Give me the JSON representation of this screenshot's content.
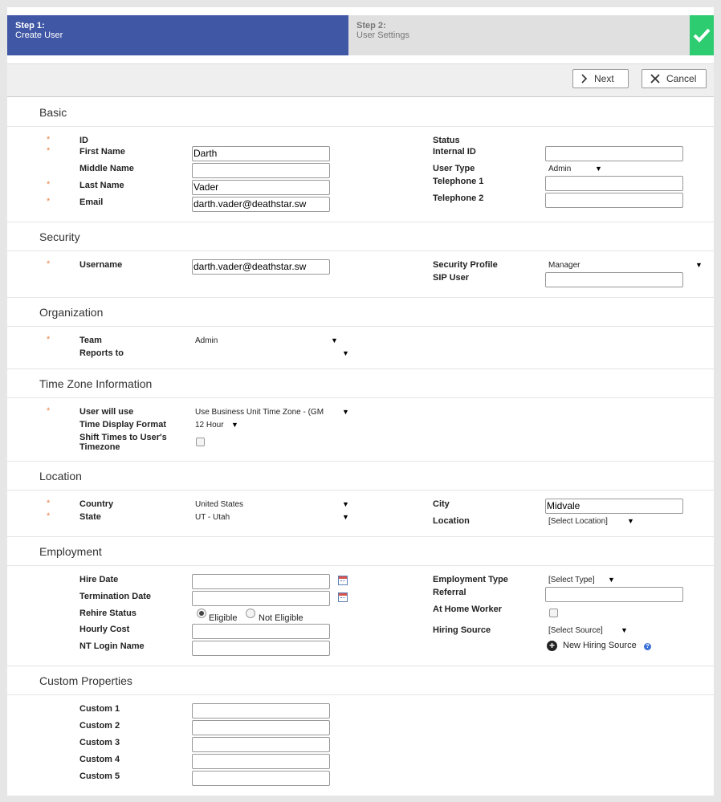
{
  "wizard": {
    "step1_title": "Step 1:",
    "step1_sub": "Create User",
    "step2_title": "Step 2:",
    "step2_sub": "User Settings",
    "complete_icon": "checkmark-icon"
  },
  "toolbar": {
    "next_label": "Next",
    "cancel_label": "Cancel"
  },
  "basic": {
    "title": "Basic",
    "id_label": "ID",
    "first_name_label": "First Name",
    "first_name_value": "Darth",
    "middle_name_label": "Middle Name",
    "middle_name_value": "",
    "last_name_label": "Last Name",
    "last_name_value": "Vader",
    "email_label": "Email",
    "email_value": "darth.vader@deathstar.sw",
    "status_label": "Status",
    "internal_id_label": "Internal ID",
    "internal_id_value": "",
    "user_type_label": "User Type",
    "user_type_value": "Admin",
    "telephone1_label": "Telephone 1",
    "telephone1_value": "",
    "telephone2_label": "Telephone 2",
    "telephone2_value": ""
  },
  "security": {
    "title": "Security",
    "username_label": "Username",
    "username_value": "darth.vader@deathstar.sw",
    "profile_label": "Security Profile",
    "profile_value": "Manager",
    "sip_label": "SIP User",
    "sip_value": ""
  },
  "organization": {
    "title": "Organization",
    "team_label": "Team",
    "team_value": "Admin",
    "reports_label": "Reports to",
    "reports_value": ""
  },
  "timezone": {
    "title": "Time Zone Information",
    "use_label": "User will use",
    "use_value": "Use Business Unit Time Zone - (GM",
    "format_label": "Time Display Format",
    "format_value": "12 Hour",
    "shift_label_1": "Shift Times to User's",
    "shift_label_2": "Timezone"
  },
  "location": {
    "title": "Location",
    "country_label": "Country",
    "country_value": "United States",
    "state_label": "State",
    "state_value": "UT - Utah",
    "city_label": "City",
    "city_value": "Midvale",
    "location_label": "Location",
    "location_value": "[Select Location]"
  },
  "employment": {
    "title": "Employment",
    "hire_label": "Hire Date",
    "hire_value": "",
    "term_label": "Termination Date",
    "term_value": "",
    "rehire_label": "Rehire Status",
    "eligible_label": "Eligible",
    "not_eligible_label": "Not Eligible",
    "cost_label": "Hourly Cost",
    "cost_value": "",
    "nt_label": "NT Login Name",
    "nt_value": "",
    "type_label": "Employment Type",
    "type_value": "[Select Type]",
    "referral_label": "Referral",
    "referral_value": "",
    "home_label": "At Home Worker",
    "source_label": "Hiring Source",
    "source_value": "[Select Source]",
    "new_source_label": "New Hiring Source",
    "help_glyph": "?"
  },
  "custom": {
    "title": "Custom Properties",
    "c1_label": "Custom 1",
    "c2_label": "Custom 2",
    "c3_label": "Custom 3",
    "c4_label": "Custom 4",
    "c5_label": "Custom 5"
  },
  "common": {
    "required_marker": "*",
    "arrow": "▼",
    "plus": "+"
  },
  "colors": {
    "step_active": "#3f57a4",
    "complete": "#2ecc71",
    "required": "#e8834a"
  }
}
